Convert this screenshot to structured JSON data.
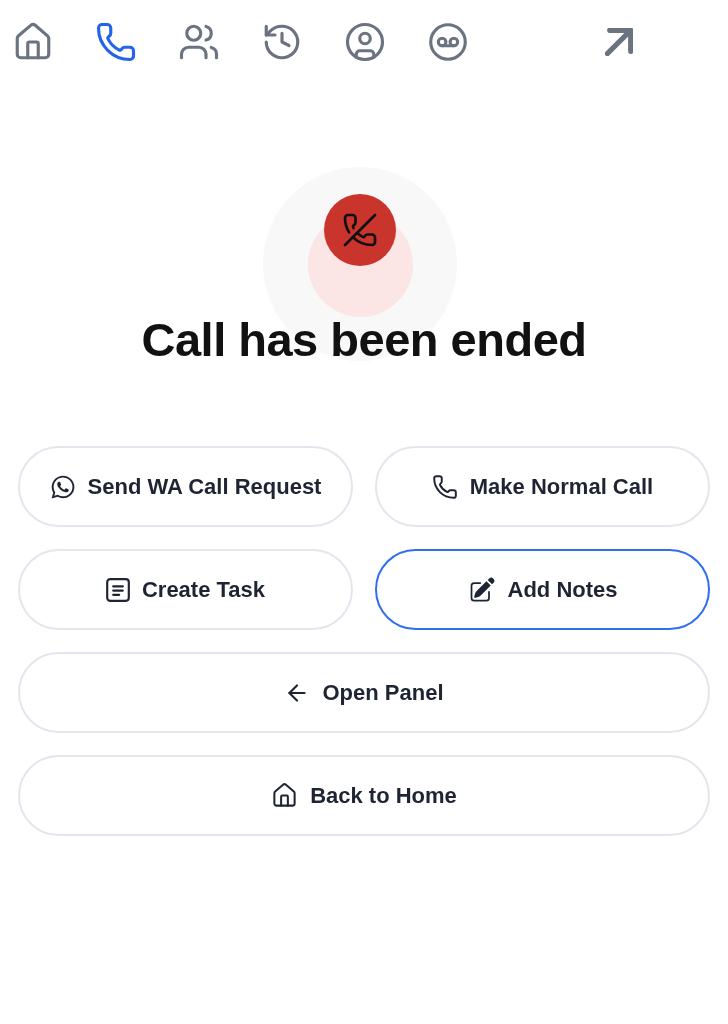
{
  "nav": [
    {
      "kind": "home",
      "selected": false
    },
    {
      "kind": "phone",
      "selected": true
    },
    {
      "kind": "contacts",
      "selected": false
    },
    {
      "kind": "history",
      "selected": false
    },
    {
      "kind": "profile",
      "selected": false
    },
    {
      "kind": "voicemail",
      "selected": false
    }
  ],
  "status": {
    "title": "Call has been ended"
  },
  "action_grid": [
    {
      "label": "Send WA Call Request",
      "kind": "whatsapp",
      "selected": false
    },
    {
      "label": "Make Normal Call",
      "kind": "phone",
      "selected": false
    },
    {
      "label": "Create Task",
      "kind": "task",
      "selected": false
    },
    {
      "label": "Add Notes",
      "kind": "notes",
      "selected": true
    }
  ],
  "action_rows": [
    {
      "label": "Open Panel",
      "kind": "back",
      "selected": false
    },
    {
      "label": "Back to Home",
      "kind": "home",
      "selected": false
    }
  ]
}
